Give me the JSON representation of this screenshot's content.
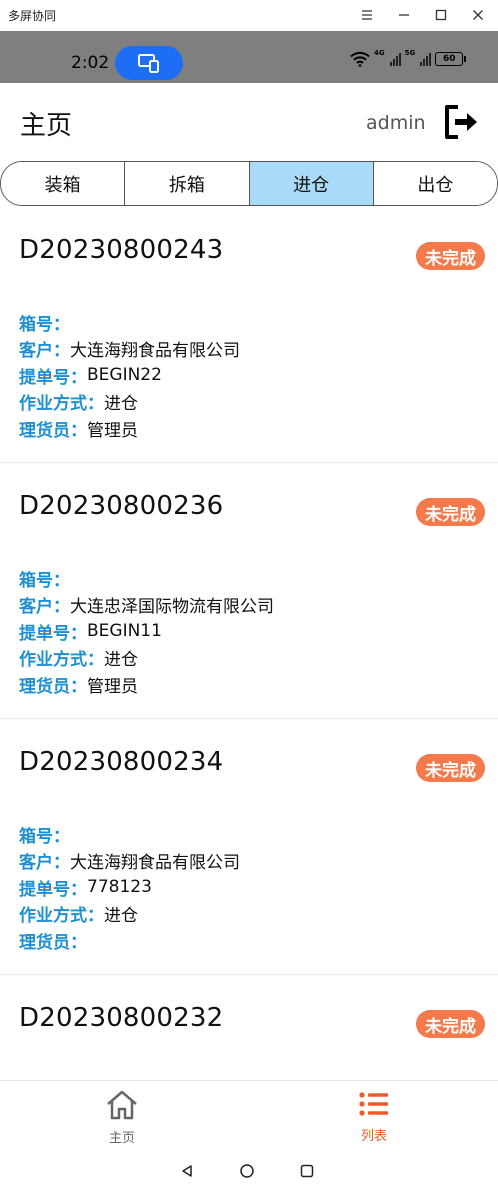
{
  "window": {
    "title": "多屏协同"
  },
  "status_bar": {
    "time": "2:02",
    "battery": "60",
    "net1": "4G",
    "net2": "5G"
  },
  "header": {
    "title": "主页",
    "user": "admin"
  },
  "tabs": [
    {
      "label": "装箱",
      "active": false
    },
    {
      "label": "拆箱",
      "active": false
    },
    {
      "label": "进仓",
      "active": true
    },
    {
      "label": "出仓",
      "active": false
    }
  ],
  "labels": {
    "box": "箱号：",
    "customer": "客户：",
    "bill": "提单号：",
    "mode": "作业方式：",
    "clerk": "理货员："
  },
  "records": [
    {
      "order_no": "D20230800243",
      "status": "未完成",
      "box": "",
      "customer": "大连海翔食品有限公司",
      "bill": "BEGIN22",
      "mode": "进仓",
      "clerk": "管理员"
    },
    {
      "order_no": "D20230800236",
      "status": "未完成",
      "box": "",
      "customer": "大连忠泽国际物流有限公司",
      "bill": "BEGIN11",
      "mode": "进仓",
      "clerk": "管理员"
    },
    {
      "order_no": "D20230800234",
      "status": "未完成",
      "box": "",
      "customer": "大连海翔食品有限公司",
      "bill": "778123",
      "mode": "进仓",
      "clerk": ""
    },
    {
      "order_no": "D20230800232",
      "status": "未完成",
      "box": "",
      "customer": "",
      "bill": "",
      "mode": "",
      "clerk": ""
    }
  ],
  "nav": {
    "home": {
      "label": "主页",
      "color": "#666666"
    },
    "list": {
      "label": "列表",
      "color": "#f05a28"
    }
  },
  "colors": {
    "accent": "#1e90d2",
    "badge": "#f47a4c",
    "tab_active": "#a9daf8",
    "status_pill": "#1e6df5"
  }
}
